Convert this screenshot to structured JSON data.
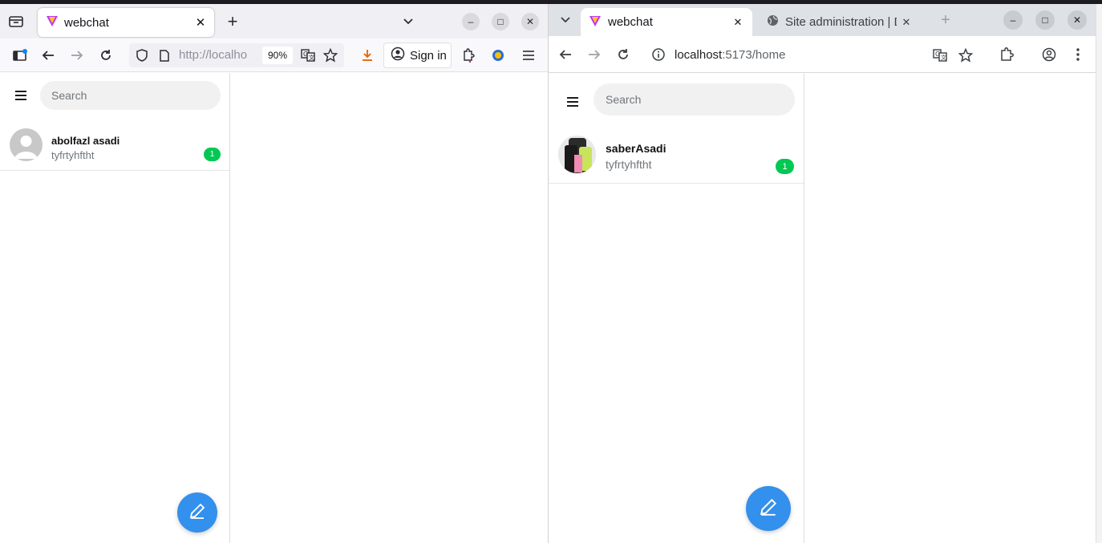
{
  "firefox": {
    "tab_title": "webchat",
    "url_text": "http://localho",
    "zoom": "90%",
    "sign_in_label": "Sign in"
  },
  "chrome": {
    "tabs": [
      {
        "title": "webchat",
        "active": true
      },
      {
        "title": "Site administration | D",
        "active": false
      }
    ],
    "url_host": "localhost",
    "url_path": ":5173/home"
  },
  "app_left": {
    "search_placeholder": "Search",
    "chats": [
      {
        "name": "abolfazl asadi",
        "last_message": "tyfrtyhftht",
        "unread": "1"
      }
    ]
  },
  "app_right": {
    "search_placeholder": "Search",
    "chats": [
      {
        "name": "saberAsadi",
        "last_message": "tyfrtyhftht",
        "unread": "1"
      }
    ]
  },
  "colors": {
    "accent_fab": "#3390ec",
    "unread_badge": "#00c853"
  },
  "icons": {
    "menu": "hamburger-icon",
    "compose": "pencil-icon"
  }
}
